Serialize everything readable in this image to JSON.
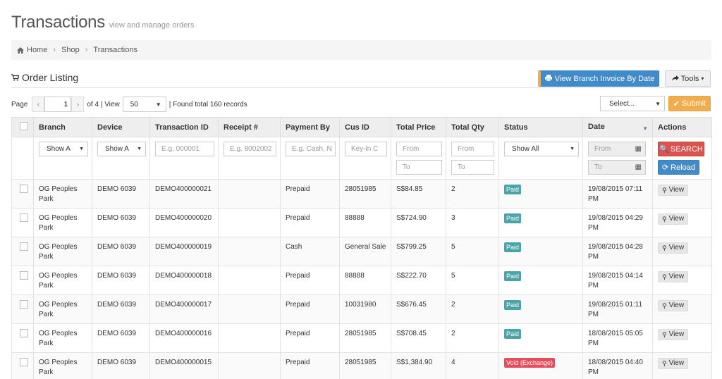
{
  "header": {
    "title": "Transactions",
    "subtitle": "view and manage orders"
  },
  "breadcrumb": [
    "Home",
    "Shop",
    "Transactions"
  ],
  "section": {
    "title": "Order Listing",
    "view_invoice_label": "View Branch Invoice By Date",
    "tools_label": "Tools"
  },
  "pager": {
    "page_label": "Page",
    "current_page": "1",
    "of_label": "of 4 | View",
    "page_size": "50",
    "records_label": "| Found total 160 records"
  },
  "bulk": {
    "select_placeholder": "Select...",
    "submit_label": "Submit"
  },
  "columns": [
    "Branch",
    "Device",
    "Transaction ID",
    "Receipt #",
    "Payment By",
    "Cus ID",
    "Total Price",
    "Total Qty",
    "Status",
    "Date",
    "Actions"
  ],
  "filters": {
    "branch": "Show A",
    "device": "Show A",
    "transaction_id": "E.g. 000001",
    "receipt": "E.g. 8002002",
    "payment_by": "E.g. Cash, N",
    "cus_id": "Key-in C",
    "price_from": "From",
    "price_to": "To",
    "qty_from": "From",
    "qty_to": "To",
    "status": "Show All",
    "date_from": "From",
    "date_to": "To",
    "search_label": "SEARCH",
    "reload_label": "Reload"
  },
  "rows": [
    {
      "branch": "OG Peoples Park",
      "device": "DEMO 6039",
      "txn": "DEMO400000021",
      "receipt": "",
      "payment": "Prepaid",
      "cus": "28051985",
      "price": "S$84.85",
      "qty": "2",
      "status": "Paid",
      "date": "19/08/2015 07:11 PM",
      "action": "View"
    },
    {
      "branch": "OG Peoples Park",
      "device": "DEMO 6039",
      "txn": "DEMO400000020",
      "receipt": "",
      "payment": "Prepaid",
      "cus": "88888",
      "price": "S$724.90",
      "qty": "3",
      "status": "Paid",
      "date": "19/08/2015 04:29 PM",
      "action": "View"
    },
    {
      "branch": "OG Peoples Park",
      "device": "DEMO 6039",
      "txn": "DEMO400000019",
      "receipt": "",
      "payment": "Cash",
      "cus": "General Sale",
      "price": "S$799.25",
      "qty": "5",
      "status": "Paid",
      "date": "19/08/2015 04:28 PM",
      "action": "View"
    },
    {
      "branch": "OG Peoples Park",
      "device": "DEMO 6039",
      "txn": "DEMO400000018",
      "receipt": "",
      "payment": "Prepaid",
      "cus": "88888",
      "price": "S$222.70",
      "qty": "5",
      "status": "Paid",
      "date": "19/08/2015 04:14 PM",
      "action": "View"
    },
    {
      "branch": "OG Peoples Park",
      "device": "DEMO 6039",
      "txn": "DEMO400000017",
      "receipt": "",
      "payment": "Prepaid",
      "cus": "10031980",
      "price": "S$676.45",
      "qty": "2",
      "status": "Paid",
      "date": "19/08/2015 01:11 PM",
      "action": "View"
    },
    {
      "branch": "OG Peoples Park",
      "device": "DEMO 6039",
      "txn": "DEMO400000016",
      "receipt": "",
      "payment": "Prepaid",
      "cus": "28051985",
      "price": "S$708.45",
      "qty": "2",
      "status": "Paid",
      "date": "18/08/2015 05:05 PM",
      "action": "View"
    },
    {
      "branch": "OG Peoples Park",
      "device": "DEMO 6039",
      "txn": "DEMO400000015",
      "receipt": "",
      "payment": "Prepaid",
      "cus": "28051985",
      "price": "S$1,384.90",
      "qty": "4",
      "status": "Void (Exchange)",
      "date": "18/08/2015 04:40 PM",
      "action": "View"
    }
  ],
  "colors": {
    "primary": "#428bca",
    "submit": "#f0ad4e",
    "search": "#d9534f",
    "paid": "#4aa3a8",
    "void": "#e74c5b"
  }
}
